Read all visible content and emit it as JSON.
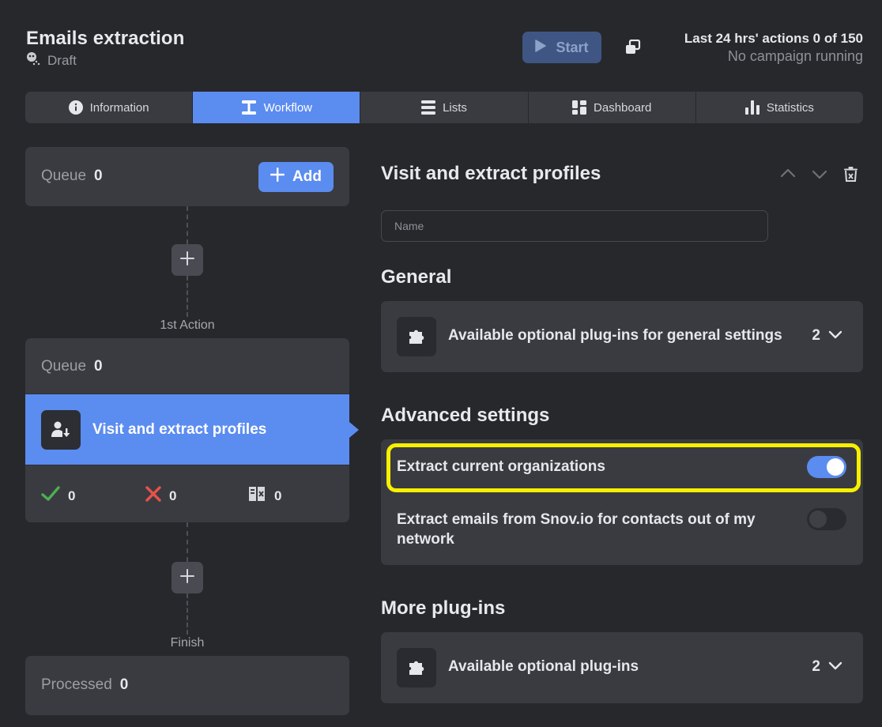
{
  "header": {
    "title": "Emails extraction",
    "status": "Draft",
    "start_label": "Start",
    "actions_text": "Last 24 hrs' actions 0 of 150",
    "campaign_text": "No campaign running"
  },
  "tabs": [
    {
      "label": "Information",
      "icon": "info-icon"
    },
    {
      "label": "Workflow",
      "icon": "workflow-icon",
      "active": true
    },
    {
      "label": "Lists",
      "icon": "list-icon"
    },
    {
      "label": "Dashboard",
      "icon": "dashboard-icon"
    },
    {
      "label": "Statistics",
      "icon": "bar-chart-icon"
    }
  ],
  "workflow": {
    "queue": {
      "label": "Queue",
      "count": "0",
      "add_label": "Add"
    },
    "first_action_label": "1st Action",
    "action": {
      "queue_label": "Queue",
      "queue_count": "0",
      "step_label": "Visit and extract profiles",
      "success_count": "0",
      "failed_count": "0",
      "skipped_count": "0"
    },
    "finish_label": "Finish",
    "processed": {
      "label": "Processed",
      "count": "0"
    }
  },
  "panel": {
    "step_title": "Visit and extract profiles",
    "name_placeholder": "Name",
    "general_heading": "General",
    "general_plugins": {
      "label": "Available optional plug-ins for general settings",
      "count": "2"
    },
    "advanced_heading": "Advanced settings",
    "advanced_settings": [
      {
        "label": "Extract current organizations",
        "enabled": true
      },
      {
        "label": "Extract emails from Snov.io for contacts out of my network",
        "enabled": false
      }
    ],
    "more_heading": "More plug-ins",
    "more_plugins": {
      "label": "Available optional plug-ins",
      "count": "2"
    }
  },
  "colors": {
    "accent": "#5b8cf0",
    "background": "#27282c",
    "card": "#3a3b41",
    "highlight": "#f7f000",
    "success": "#4caf50",
    "error": "#e5534b"
  }
}
